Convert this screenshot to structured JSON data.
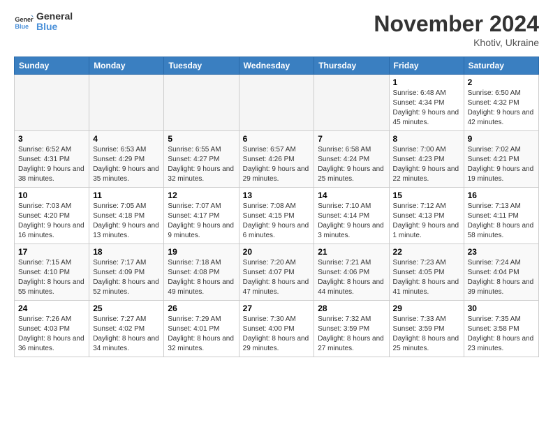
{
  "logo": {
    "text_general": "General",
    "text_blue": "Blue"
  },
  "title": "November 2024",
  "location": "Khotiv, Ukraine",
  "weekdays": [
    "Sunday",
    "Monday",
    "Tuesday",
    "Wednesday",
    "Thursday",
    "Friday",
    "Saturday"
  ],
  "weeks": [
    [
      {
        "day": "",
        "info": ""
      },
      {
        "day": "",
        "info": ""
      },
      {
        "day": "",
        "info": ""
      },
      {
        "day": "",
        "info": ""
      },
      {
        "day": "",
        "info": ""
      },
      {
        "day": "1",
        "info": "Sunrise: 6:48 AM\nSunset: 4:34 PM\nDaylight: 9 hours and 45 minutes."
      },
      {
        "day": "2",
        "info": "Sunrise: 6:50 AM\nSunset: 4:32 PM\nDaylight: 9 hours and 42 minutes."
      }
    ],
    [
      {
        "day": "3",
        "info": "Sunrise: 6:52 AM\nSunset: 4:31 PM\nDaylight: 9 hours and 38 minutes."
      },
      {
        "day": "4",
        "info": "Sunrise: 6:53 AM\nSunset: 4:29 PM\nDaylight: 9 hours and 35 minutes."
      },
      {
        "day": "5",
        "info": "Sunrise: 6:55 AM\nSunset: 4:27 PM\nDaylight: 9 hours and 32 minutes."
      },
      {
        "day": "6",
        "info": "Sunrise: 6:57 AM\nSunset: 4:26 PM\nDaylight: 9 hours and 29 minutes."
      },
      {
        "day": "7",
        "info": "Sunrise: 6:58 AM\nSunset: 4:24 PM\nDaylight: 9 hours and 25 minutes."
      },
      {
        "day": "8",
        "info": "Sunrise: 7:00 AM\nSunset: 4:23 PM\nDaylight: 9 hours and 22 minutes."
      },
      {
        "day": "9",
        "info": "Sunrise: 7:02 AM\nSunset: 4:21 PM\nDaylight: 9 hours and 19 minutes."
      }
    ],
    [
      {
        "day": "10",
        "info": "Sunrise: 7:03 AM\nSunset: 4:20 PM\nDaylight: 9 hours and 16 minutes."
      },
      {
        "day": "11",
        "info": "Sunrise: 7:05 AM\nSunset: 4:18 PM\nDaylight: 9 hours and 13 minutes."
      },
      {
        "day": "12",
        "info": "Sunrise: 7:07 AM\nSunset: 4:17 PM\nDaylight: 9 hours and 9 minutes."
      },
      {
        "day": "13",
        "info": "Sunrise: 7:08 AM\nSunset: 4:15 PM\nDaylight: 9 hours and 6 minutes."
      },
      {
        "day": "14",
        "info": "Sunrise: 7:10 AM\nSunset: 4:14 PM\nDaylight: 9 hours and 3 minutes."
      },
      {
        "day": "15",
        "info": "Sunrise: 7:12 AM\nSunset: 4:13 PM\nDaylight: 9 hours and 1 minute."
      },
      {
        "day": "16",
        "info": "Sunrise: 7:13 AM\nSunset: 4:11 PM\nDaylight: 8 hours and 58 minutes."
      }
    ],
    [
      {
        "day": "17",
        "info": "Sunrise: 7:15 AM\nSunset: 4:10 PM\nDaylight: 8 hours and 55 minutes."
      },
      {
        "day": "18",
        "info": "Sunrise: 7:17 AM\nSunset: 4:09 PM\nDaylight: 8 hours and 52 minutes."
      },
      {
        "day": "19",
        "info": "Sunrise: 7:18 AM\nSunset: 4:08 PM\nDaylight: 8 hours and 49 minutes."
      },
      {
        "day": "20",
        "info": "Sunrise: 7:20 AM\nSunset: 4:07 PM\nDaylight: 8 hours and 47 minutes."
      },
      {
        "day": "21",
        "info": "Sunrise: 7:21 AM\nSunset: 4:06 PM\nDaylight: 8 hours and 44 minutes."
      },
      {
        "day": "22",
        "info": "Sunrise: 7:23 AM\nSunset: 4:05 PM\nDaylight: 8 hours and 41 minutes."
      },
      {
        "day": "23",
        "info": "Sunrise: 7:24 AM\nSunset: 4:04 PM\nDaylight: 8 hours and 39 minutes."
      }
    ],
    [
      {
        "day": "24",
        "info": "Sunrise: 7:26 AM\nSunset: 4:03 PM\nDaylight: 8 hours and 36 minutes."
      },
      {
        "day": "25",
        "info": "Sunrise: 7:27 AM\nSunset: 4:02 PM\nDaylight: 8 hours and 34 minutes."
      },
      {
        "day": "26",
        "info": "Sunrise: 7:29 AM\nSunset: 4:01 PM\nDaylight: 8 hours and 32 minutes."
      },
      {
        "day": "27",
        "info": "Sunrise: 7:30 AM\nSunset: 4:00 PM\nDaylight: 8 hours and 29 minutes."
      },
      {
        "day": "28",
        "info": "Sunrise: 7:32 AM\nSunset: 3:59 PM\nDaylight: 8 hours and 27 minutes."
      },
      {
        "day": "29",
        "info": "Sunrise: 7:33 AM\nSunset: 3:59 PM\nDaylight: 8 hours and 25 minutes."
      },
      {
        "day": "30",
        "info": "Sunrise: 7:35 AM\nSunset: 3:58 PM\nDaylight: 8 hours and 23 minutes."
      }
    ]
  ]
}
